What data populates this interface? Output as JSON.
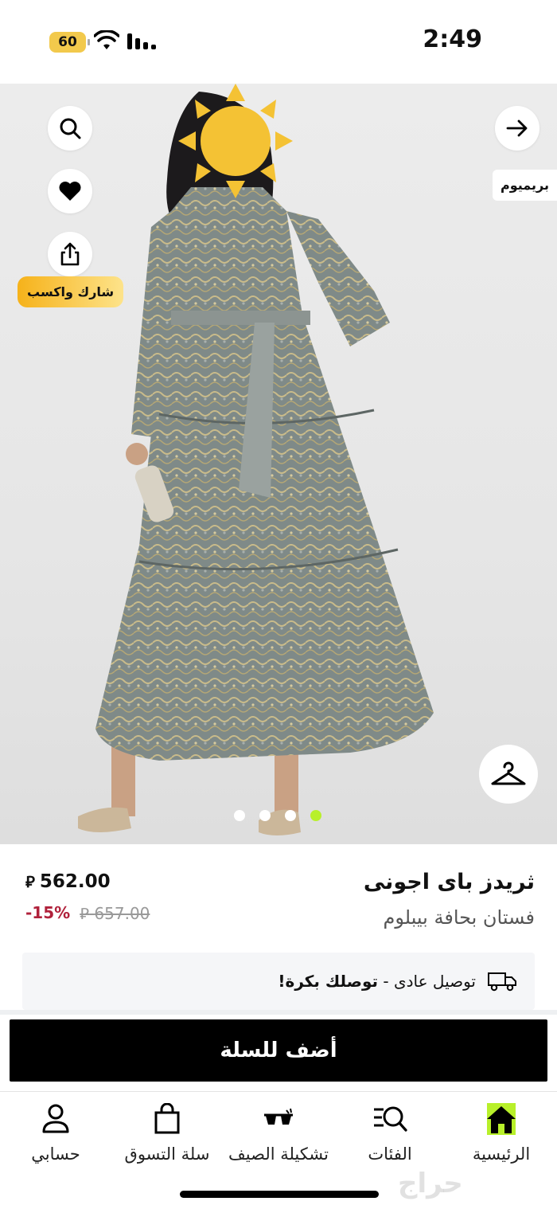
{
  "status_bar": {
    "time": "2:49",
    "battery_level": "60",
    "battery_color": "#f2c94c"
  },
  "hero": {
    "premium_tag": "بريميوم",
    "share_earn_label": "شارك واكسب",
    "image_count": 4,
    "active_image_index": 3,
    "active_dot_color": "#b8f02a",
    "icons": [
      "search-icon",
      "heart-icon",
      "share-icon",
      "arrow-right-icon",
      "hanger-icon"
    ]
  },
  "product": {
    "brand": "ثريدز باى اجونى",
    "name": "فستان بحافة بيبلوم",
    "price": "562.00",
    "currency_symbol": "⃁",
    "old_price": "657.00",
    "discount": "-15%",
    "discount_color": "#b0213b"
  },
  "delivery": {
    "standard": "توصيل عادى - ",
    "highlight": "توصلك بكرة!",
    "icon": "truck-icon"
  },
  "cart": {
    "add_label": "أضف للسلة"
  },
  "bottom_nav": {
    "items": [
      {
        "label": "الرئيسية",
        "icon": "home-icon"
      },
      {
        "label": "الفئات",
        "icon": "categories-search-icon"
      },
      {
        "label": "تشكيلة الصيف",
        "icon": "sunglasses-icon"
      },
      {
        "label": "سلة التسوق",
        "icon": "shopping-bag-icon"
      },
      {
        "label": "حسابي",
        "icon": "user-icon"
      }
    ],
    "active_color": "#b8f02a"
  },
  "watermark": "حراج"
}
